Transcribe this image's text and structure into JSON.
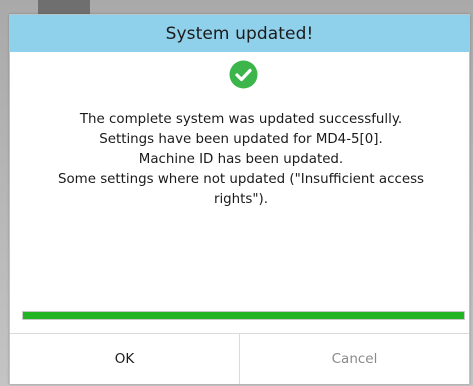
{
  "dialog": {
    "title": "System updated!",
    "status_icon": "check-circle-icon",
    "status_color": "#3cb54a",
    "header_color": "#8fd0ea",
    "message_lines": [
      "The complete system was updated successfully.",
      "Settings have been updated for MD4-5[0].",
      "Machine ID has been updated.",
      "Some settings where not updated (\"Insufficient access",
      "rights\")."
    ],
    "progress": {
      "percent": 100,
      "color": "#22b422"
    },
    "buttons": {
      "ok_label": "OK",
      "cancel_label": "Cancel"
    }
  }
}
